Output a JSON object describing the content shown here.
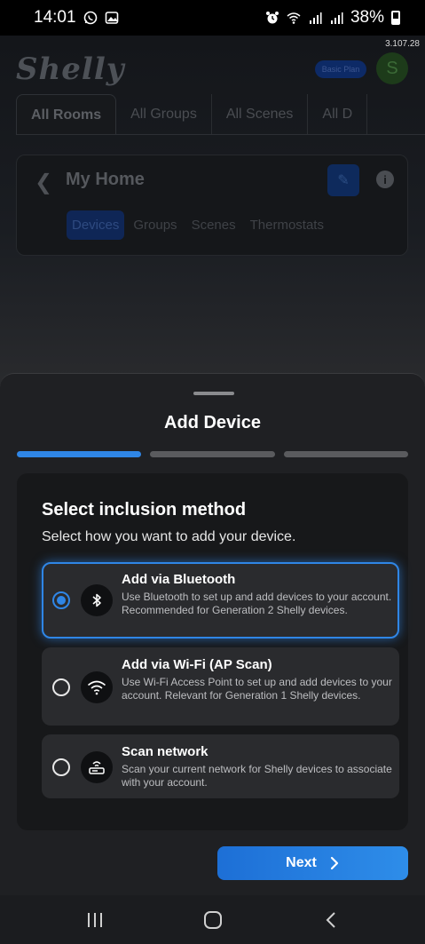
{
  "status_bar": {
    "time": "14:01",
    "left_icons": [
      "whatsapp-icon",
      "gallery-icon"
    ],
    "right_icons": [
      "alarm-icon",
      "wifi-icon",
      "signal-icon",
      "signal-icon-2"
    ],
    "battery": "38%"
  },
  "app": {
    "version": "3.107.28",
    "logo_text": "Shelly",
    "plan_badge": "Basic Plan",
    "avatar_initial": "S",
    "tabs": [
      {
        "label": "All Rooms",
        "active": true
      },
      {
        "label": "All Groups",
        "active": false
      },
      {
        "label": "All Scenes",
        "active": false
      },
      {
        "label": "All D",
        "active": false
      }
    ],
    "home": {
      "title": "My Home",
      "subtabs": [
        {
          "label": "Devices",
          "active": true
        },
        {
          "label": "Groups",
          "active": false
        },
        {
          "label": "Scenes",
          "active": false
        },
        {
          "label": "Thermostats",
          "active": false
        }
      ]
    }
  },
  "sheet": {
    "title": "Add Device",
    "steps": [
      {
        "active": true
      },
      {
        "active": false
      },
      {
        "active": false
      }
    ],
    "panel_title": "Select inclusion method",
    "panel_subtitle": "Select how you want to add your device.",
    "options": [
      {
        "title": "Add via Bluetooth",
        "description": "Use Bluetooth to set up and add devices to your account. Recommended for Generation 2 Shelly devices.",
        "icon": "bluetooth-icon",
        "selected": true
      },
      {
        "title": "Add via Wi-Fi (AP Scan)",
        "description": "Use Wi-Fi Access Point to set up and add devices to your account. Relevant for Generation 1 Shelly devices.",
        "icon": "wifi-icon",
        "selected": false
      },
      {
        "title": "Scan network",
        "description": "Scan your current network for Shelly devices to associate with your account.",
        "icon": "router-icon",
        "selected": false
      }
    ],
    "next_label": "Next"
  },
  "colors": {
    "accent": "#2f86e6",
    "sheet_bg": "#1f2023",
    "panel_bg": "#17181a",
    "option_bg": "#2a2b2e"
  }
}
